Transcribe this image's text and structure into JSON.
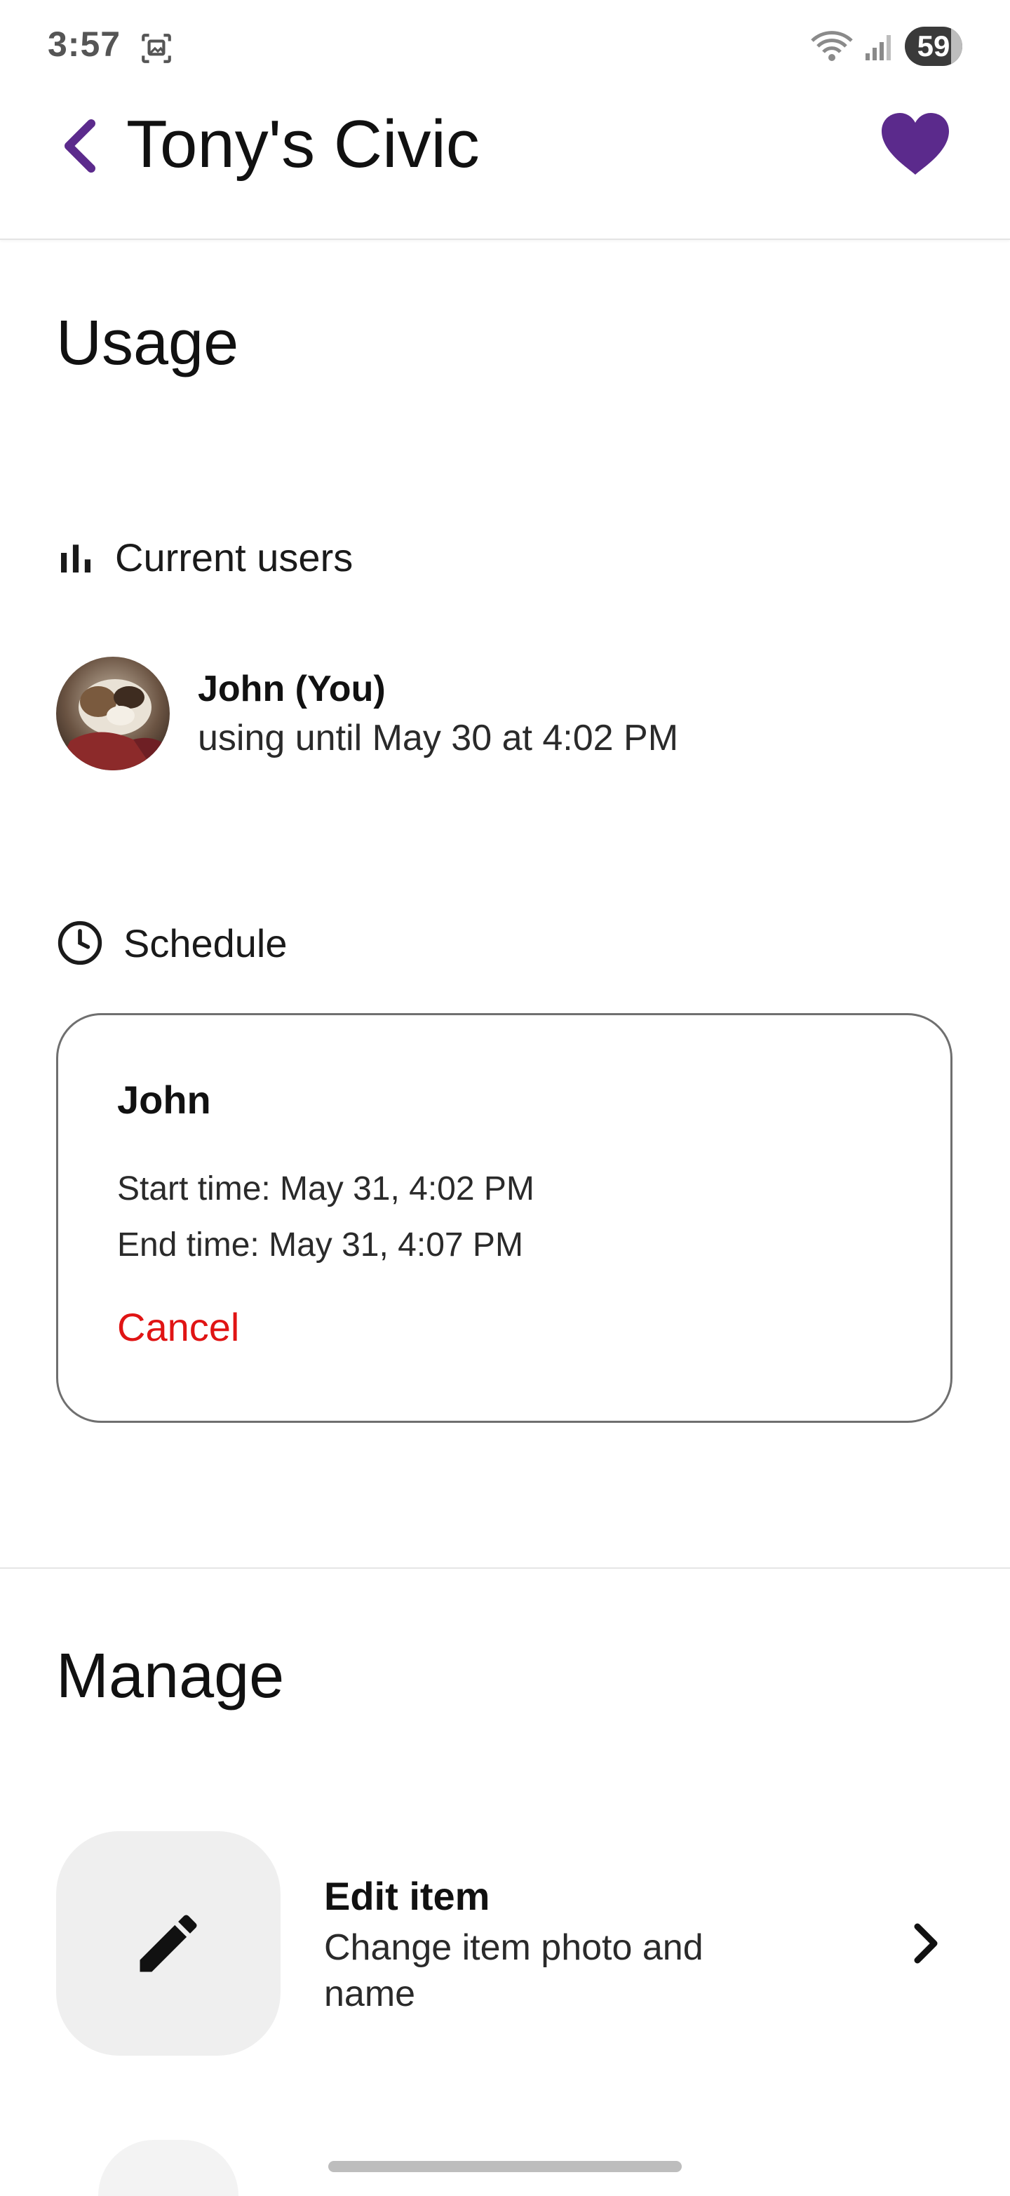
{
  "status_bar": {
    "time": "3:57",
    "battery": "59"
  },
  "app_bar": {
    "title": "Tony's Civic"
  },
  "colors": {
    "accent": "#5b2a8c",
    "danger": "#e01414"
  },
  "usage": {
    "title": "Usage",
    "current_users": {
      "label": "Current users",
      "icon": "bar-chart-icon",
      "user": {
        "name": "John (You)",
        "status": "using until May 30 at 4:02 PM"
      }
    },
    "schedule": {
      "label": "Schedule",
      "icon": "clock-icon",
      "entry": {
        "name": "John",
        "start": "Start time: May 31, 4:02 PM",
        "end": "End time: May 31, 4:07 PM",
        "cancel": "Cancel"
      }
    }
  },
  "manage": {
    "title": "Manage",
    "items": [
      {
        "icon": "pencil-icon",
        "title": "Edit item",
        "description": "Change item photo and name"
      }
    ]
  }
}
